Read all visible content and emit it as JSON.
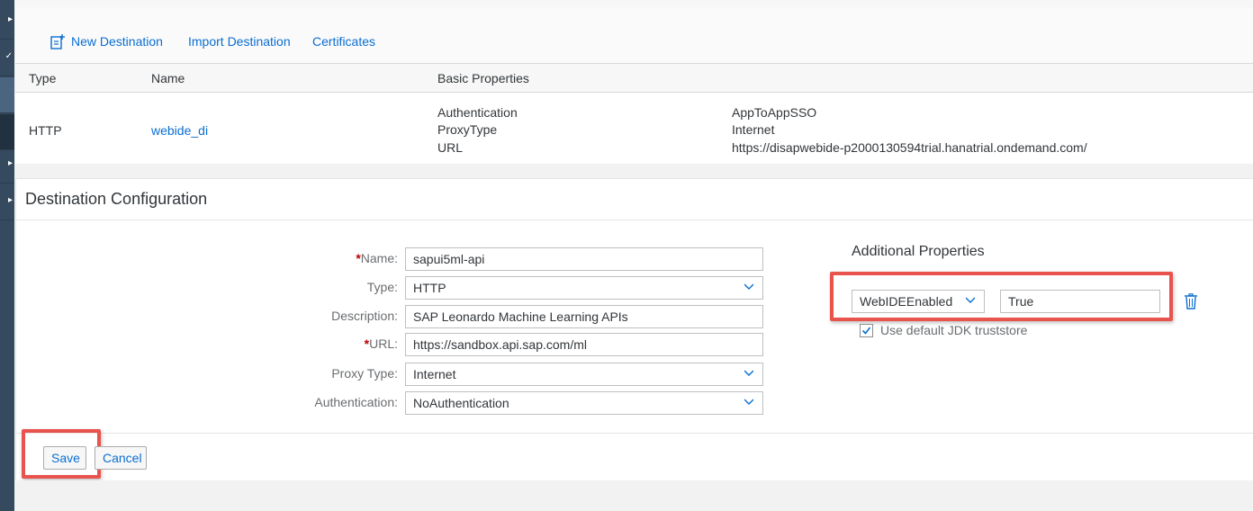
{
  "toolbar": {
    "new_destination": "New Destination",
    "import_destination": "Import Destination",
    "certificates": "Certificates"
  },
  "table": {
    "headers": [
      "Type",
      "Name",
      "Basic Properties"
    ],
    "row": {
      "type": "HTTP",
      "name": "webide_di",
      "properties": [
        {
          "key": "Authentication",
          "value": "AppToAppSSO"
        },
        {
          "key": "ProxyType",
          "value": "Internet"
        },
        {
          "key": "URL",
          "value": "https://disapwebide-p2000130594trial.hanatrial.ondemand.com/"
        }
      ]
    }
  },
  "config": {
    "title": "Destination Configuration",
    "required_marker": "*",
    "fields": {
      "name": {
        "label": "Name:",
        "value": "sapui5ml-api"
      },
      "type": {
        "label": "Type:",
        "value": "HTTP"
      },
      "description": {
        "label": "Description:",
        "value": "SAP Leonardo Machine Learning APIs"
      },
      "url": {
        "label": "URL:",
        "value": "https://sandbox.api.sap.com/ml"
      },
      "proxy_type": {
        "label": "Proxy Type:",
        "value": "Internet"
      },
      "authentication": {
        "label": "Authentication:",
        "value": "NoAuthentication"
      }
    },
    "additional_properties": {
      "title": "Additional Properties",
      "property_key": "WebIDEEnabled",
      "property_value": "True",
      "truststore_label": "Use default JDK truststore",
      "truststore_checked": true
    },
    "buttons": {
      "save": "Save",
      "cancel": "Cancel"
    }
  },
  "colors": {
    "link": "#0a6ed1",
    "highlight": "#e8534d",
    "sidebar": "#354a5f",
    "required": "#bb0000"
  },
  "icons": [
    "new-destination-icon",
    "chevron-down-icon",
    "delete-icon",
    "checkmark-icon"
  ]
}
